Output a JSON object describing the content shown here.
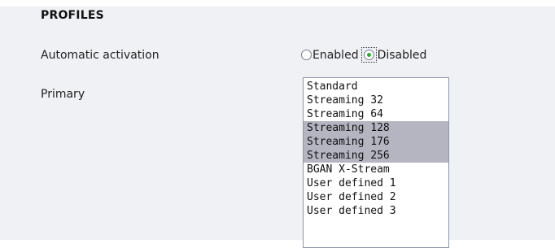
{
  "section": {
    "title": "PROFILES"
  },
  "automatic_activation": {
    "label": "Automatic activation",
    "options": [
      {
        "label": "Enabled",
        "checked": false
      },
      {
        "label": "Disabled",
        "checked": true
      }
    ]
  },
  "primary": {
    "label": "Primary",
    "options": [
      {
        "label": "Standard",
        "selected": false
      },
      {
        "label": "Streaming 32",
        "selected": false
      },
      {
        "label": "Streaming 64",
        "selected": false
      },
      {
        "label": "Streaming 128",
        "selected": true
      },
      {
        "label": "Streaming 176",
        "selected": true
      },
      {
        "label": "Streaming 256",
        "selected": true
      },
      {
        "label": "BGAN X-Stream",
        "selected": false
      },
      {
        "label": "User defined 1",
        "selected": false
      },
      {
        "label": "User defined 2",
        "selected": false
      },
      {
        "label": "User defined 3",
        "selected": false
      }
    ]
  },
  "colors": {
    "panel_bg": "#f0f1f4",
    "selected_bg": "#b5b5c2",
    "radio_dot": "#2eae2e"
  }
}
